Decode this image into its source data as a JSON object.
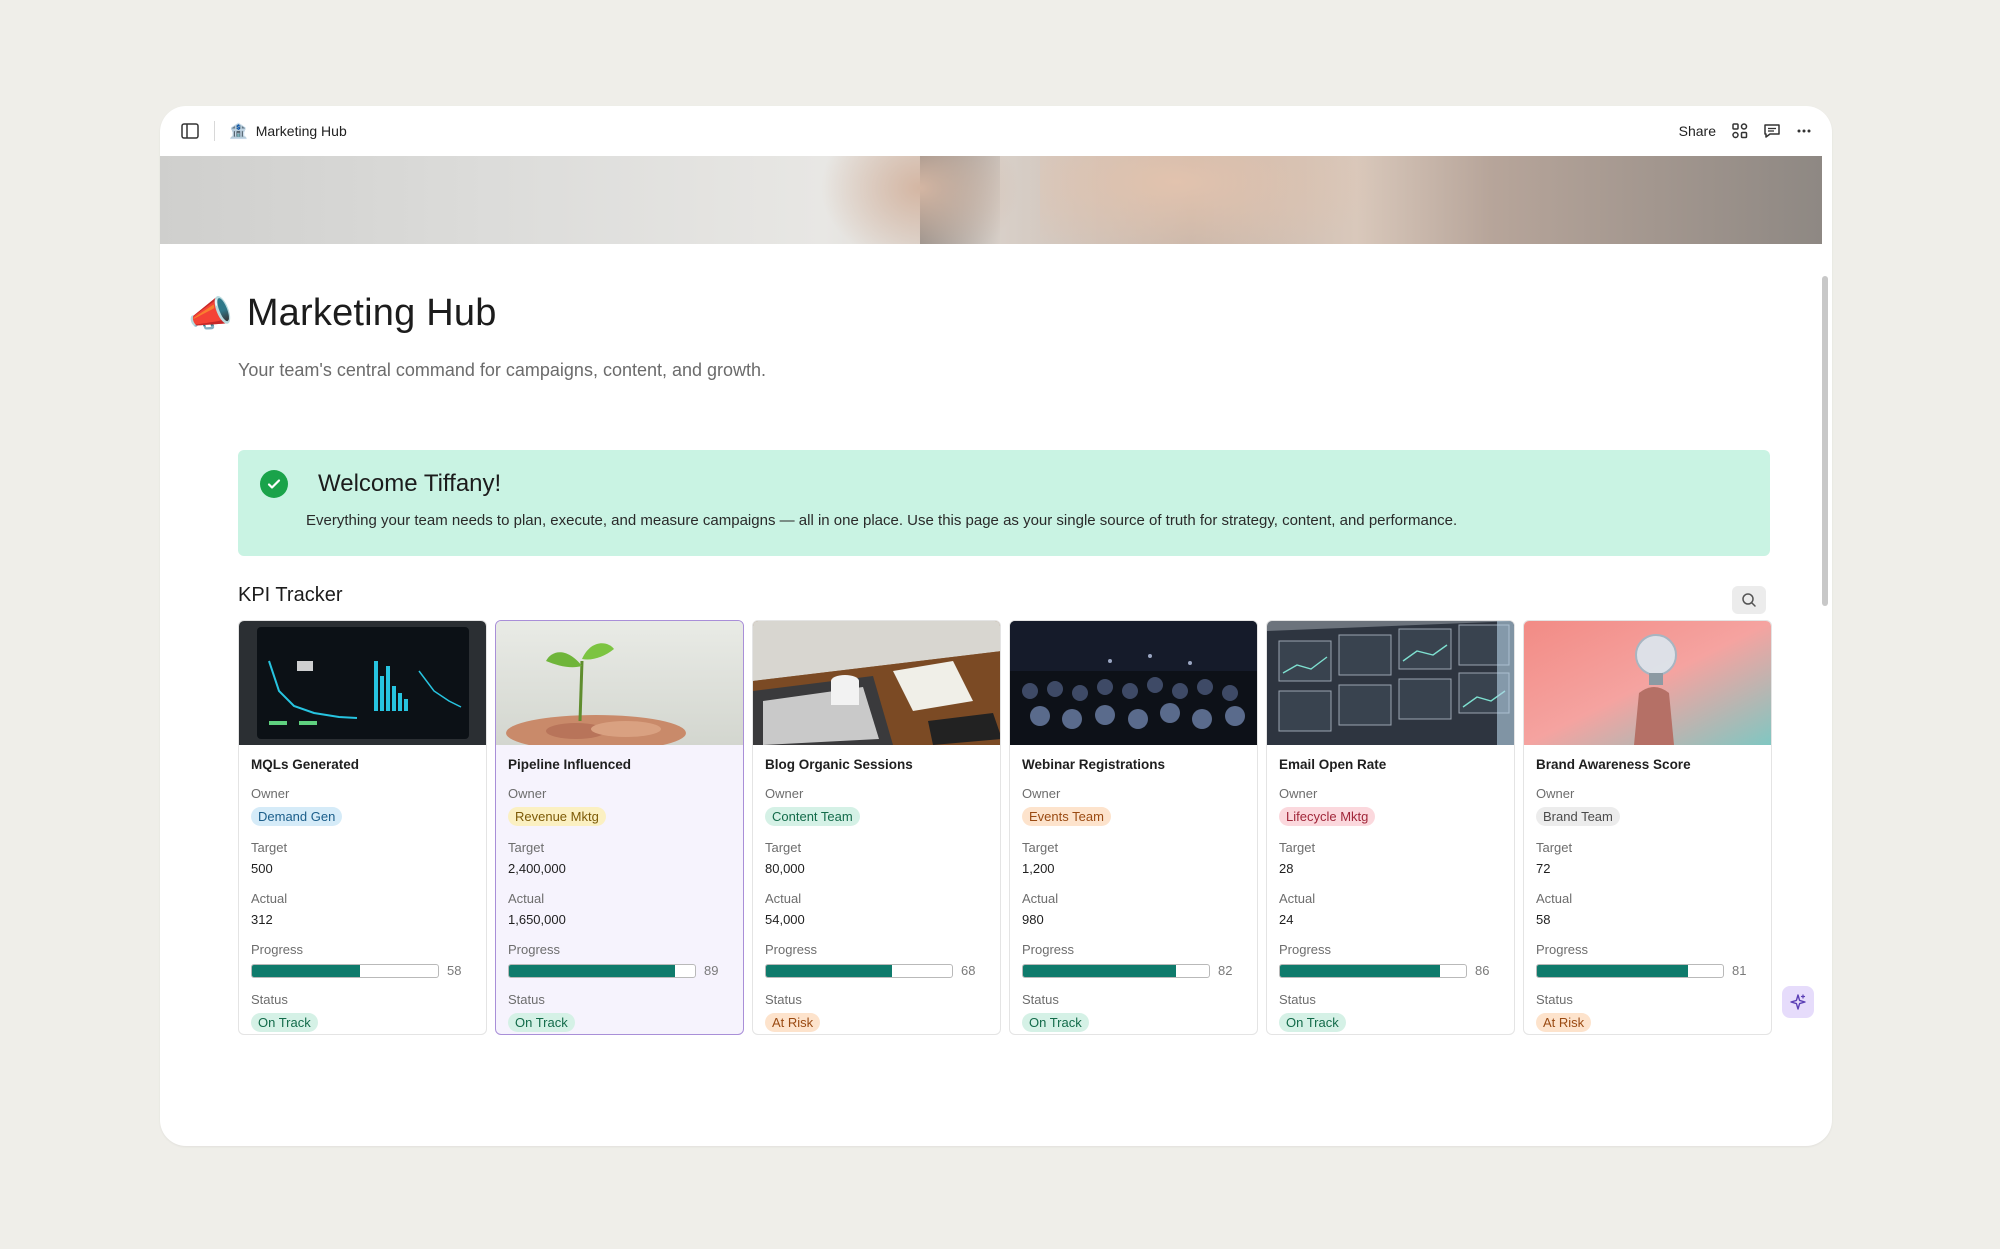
{
  "topbar": {
    "page_emoji": "🏦",
    "page_name": "Marketing Hub",
    "share_label": "Share"
  },
  "page": {
    "emoji": "📣",
    "title": "Marketing Hub",
    "subtitle": "Your team's central command for campaigns, content, and growth."
  },
  "callout": {
    "title": "Welcome Tiffany!",
    "body": "Everything your team needs to plan, execute, and measure campaigns — all in one place. Use this page as your single source of truth for strategy, content, and performance."
  },
  "kpi": {
    "section_title": "KPI Tracker",
    "labels": {
      "owner": "Owner",
      "target": "Target",
      "actual": "Actual",
      "progress": "Progress",
      "status": "Status"
    },
    "cards": [
      {
        "name": "MQLs Generated",
        "owner": "Demand Gen",
        "owner_color": "#d5ebf8",
        "owner_text_color": "#1b5e8a",
        "target": "500",
        "actual": "312",
        "progress": 58,
        "status": "On Track",
        "status_color": "#d5f1e6",
        "status_text_color": "#136b4a",
        "image": "dashboard"
      },
      {
        "name": "Pipeline Influenced",
        "owner": "Revenue Mktg",
        "owner_color": "#fbf0c2",
        "owner_text_color": "#7d5a06",
        "target": "2,400,000",
        "actual": "1,650,000",
        "progress": 89,
        "status": "On Track",
        "status_color": "#d5f1e6",
        "status_text_color": "#136b4a",
        "image": "plant"
      },
      {
        "name": "Blog Organic Sessions",
        "owner": "Content Team",
        "owner_color": "#d5f1e6",
        "owner_text_color": "#136b4a",
        "target": "80,000",
        "actual": "54,000",
        "progress": 68,
        "status": "At Risk",
        "status_color": "#fde3cc",
        "status_text_color": "#9a4a12",
        "image": "desk"
      },
      {
        "name": "Webinar Registrations",
        "owner": "Events Team",
        "owner_color": "#fde3cc",
        "owner_text_color": "#9a4a12",
        "target": "1,200",
        "actual": "980",
        "progress": 82,
        "status": "On Track",
        "status_color": "#d5f1e6",
        "status_text_color": "#136b4a",
        "image": "audience"
      },
      {
        "name": "Email Open Rate",
        "owner": "Lifecycle Mktg",
        "owner_color": "#fbd8dd",
        "owner_text_color": "#a1273a",
        "target": "28",
        "actual": "24",
        "progress": 86,
        "status": "On Track",
        "status_color": "#d5f1e6",
        "status_text_color": "#136b4a",
        "image": "screens"
      },
      {
        "name": "Brand Awareness Score",
        "owner": "Brand Team",
        "owner_color": "#ececec",
        "owner_text_color": "#4a4a4a",
        "target": "72",
        "actual": "58",
        "progress": 81,
        "status": "At Risk",
        "status_color": "#fde3cc",
        "status_text_color": "#9a4a12",
        "image": "bulb"
      }
    ]
  },
  "colors": {
    "callout_bg": "#c9f3e3",
    "progress_fill": "#0f7b6c",
    "selected_border": "#a98fd8"
  },
  "icons": [
    "sidebar-toggle-icon",
    "layout-icon",
    "comment-icon",
    "more-icon",
    "search-icon",
    "check-icon",
    "sparkle-icon"
  ]
}
